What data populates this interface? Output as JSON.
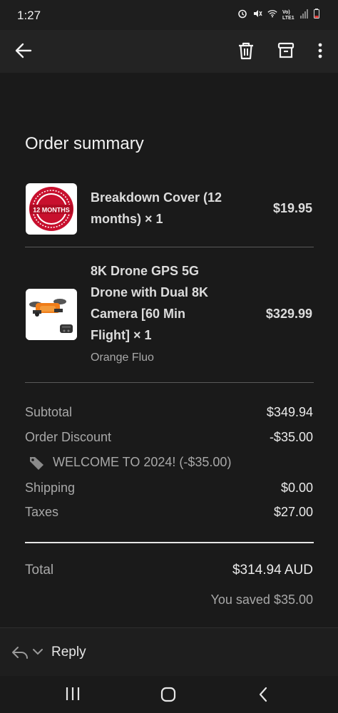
{
  "status_bar": {
    "time": "1:27",
    "network": "Vo) LTE1"
  },
  "order": {
    "title": "Order summary",
    "items": [
      {
        "name_line1": "Breakdown Cover (12",
        "name_line2": "months) × 1",
        "price": "$19.95",
        "image_icon": "warranty-badge-icon",
        "image_text": "12 MONTHS"
      },
      {
        "name_line1": "8K Drone GPS 5G",
        "name_line2": "Drone with Dual 8K",
        "name_line3": "Camera [60 Min",
        "name_line4": "Flight] × 1",
        "variant": "Orange Fluo",
        "price": "$329.99",
        "image_icon": "drone-icon"
      }
    ],
    "subtotal_label": "Subtotal",
    "subtotal_value": "$349.94",
    "discount_label": "Order Discount",
    "discount_value": "-$35.00",
    "discount_code": "WELCOME TO 2024! (-$35.00)",
    "shipping_label": "Shipping",
    "shipping_value": "$0.00",
    "taxes_label": "Taxes",
    "taxes_value": "$27.00",
    "total_label": "Total",
    "total_value": "$314.94 AUD",
    "saved_text": "You saved $35.00"
  },
  "reply_bar": {
    "label": "Reply"
  },
  "colors": {
    "background": "#1a1a1a",
    "app_bar": "#232323",
    "text_primary": "#eaeaea",
    "text_secondary": "#a8a8a8",
    "warranty_red": "#c8102e"
  }
}
